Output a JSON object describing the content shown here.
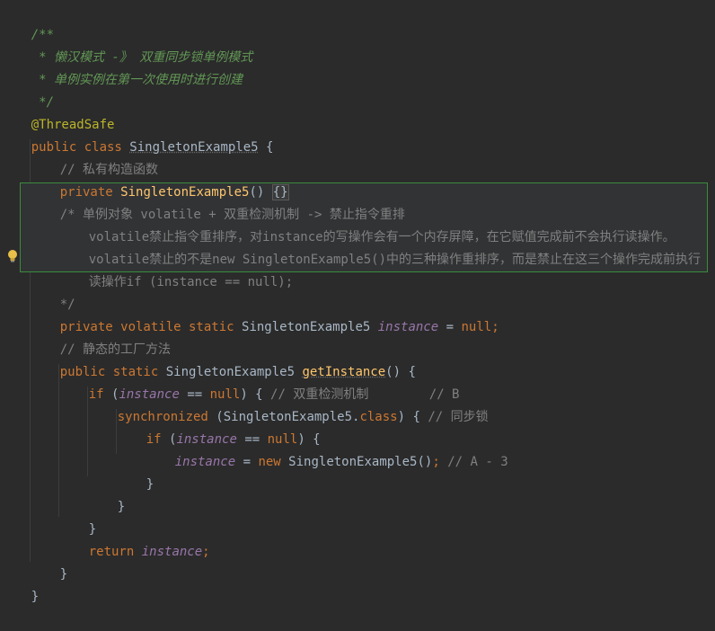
{
  "lines": {
    "l1": "/**",
    "l2": " * 懒汉模式 -》 双重同步锁单例模式",
    "l3": " * 单例实例在第一次使用时进行创建",
    "l4": " */",
    "l5": "@ThreadSafe",
    "l6_kw": "public class ",
    "l6_name": "SingletonExample5",
    "l6_rest": " {",
    "l7": "// 私有构造函数",
    "l8_kw": "private ",
    "l8_name": "SingletonExample5",
    "l8_paren": "() ",
    "l8_braces": "{}",
    "l9": "/* 单例对象 volatile + 双重检测机制 -> 禁止指令重排",
    "l10": "volatile禁止指令重排序，对instance的写操作会有一个内存屏障，在它赋值完成前不会执行读操作。",
    "l11": "volatile禁止的不是new SingletonExample5()中的三种操作重排序，而是禁止在这三个操作完成前执行",
    "l12": "读操作if (instance == null);",
    "l13": "*/",
    "l14_kw": "private volatile static ",
    "l14_type": "SingletonExample5 ",
    "l14_field": "instance",
    "l14_eq": " = ",
    "l14_null": "null",
    "l14_semi": ";",
    "l15": "// 静态的工厂方法",
    "l16_kw": "public static ",
    "l16_type": "SingletonExample5 ",
    "l16_method": "getInstance",
    "l16_rest": "() {",
    "l17_if": "if ",
    "l17_open": "(",
    "l17_field": "instance",
    "l17_eq": " == ",
    "l17_null": "null",
    "l17_rest": ") { ",
    "l17_comment": "// 双重检测机制        // B",
    "l18_kw": "synchronized ",
    "l18_open": "(SingletonExample5.",
    "l18_class": "class",
    "l18_rest": ") { ",
    "l18_comment": "// 同步锁",
    "l19_if": "if ",
    "l19_open": "(",
    "l19_field": "instance",
    "l19_eq": " == ",
    "l19_null": "null",
    "l19_rest": ") {",
    "l20_field": "instance",
    "l20_eq": " = ",
    "l20_new": "new ",
    "l20_call": "SingletonExample5()",
    "l20_semi": "; ",
    "l20_comment": "// A - 3",
    "l21": "}",
    "l22": "}",
    "l23": "}",
    "l24_kw": "return ",
    "l24_field": "instance",
    "l24_semi": ";",
    "l25": "}",
    "l26": "}"
  },
  "colors": {
    "background": "#2b2b2b",
    "keyword": "#cc7832",
    "doc_comment": "#629755",
    "line_comment": "#808080",
    "field": "#9876aa",
    "annotation": "#bbb529",
    "method_declaration": "#ffc66d",
    "default_text": "#a9b7c6",
    "highlight_border": "#3c8c3c"
  },
  "icons": {
    "intention_bulb": "lightbulb-icon"
  }
}
